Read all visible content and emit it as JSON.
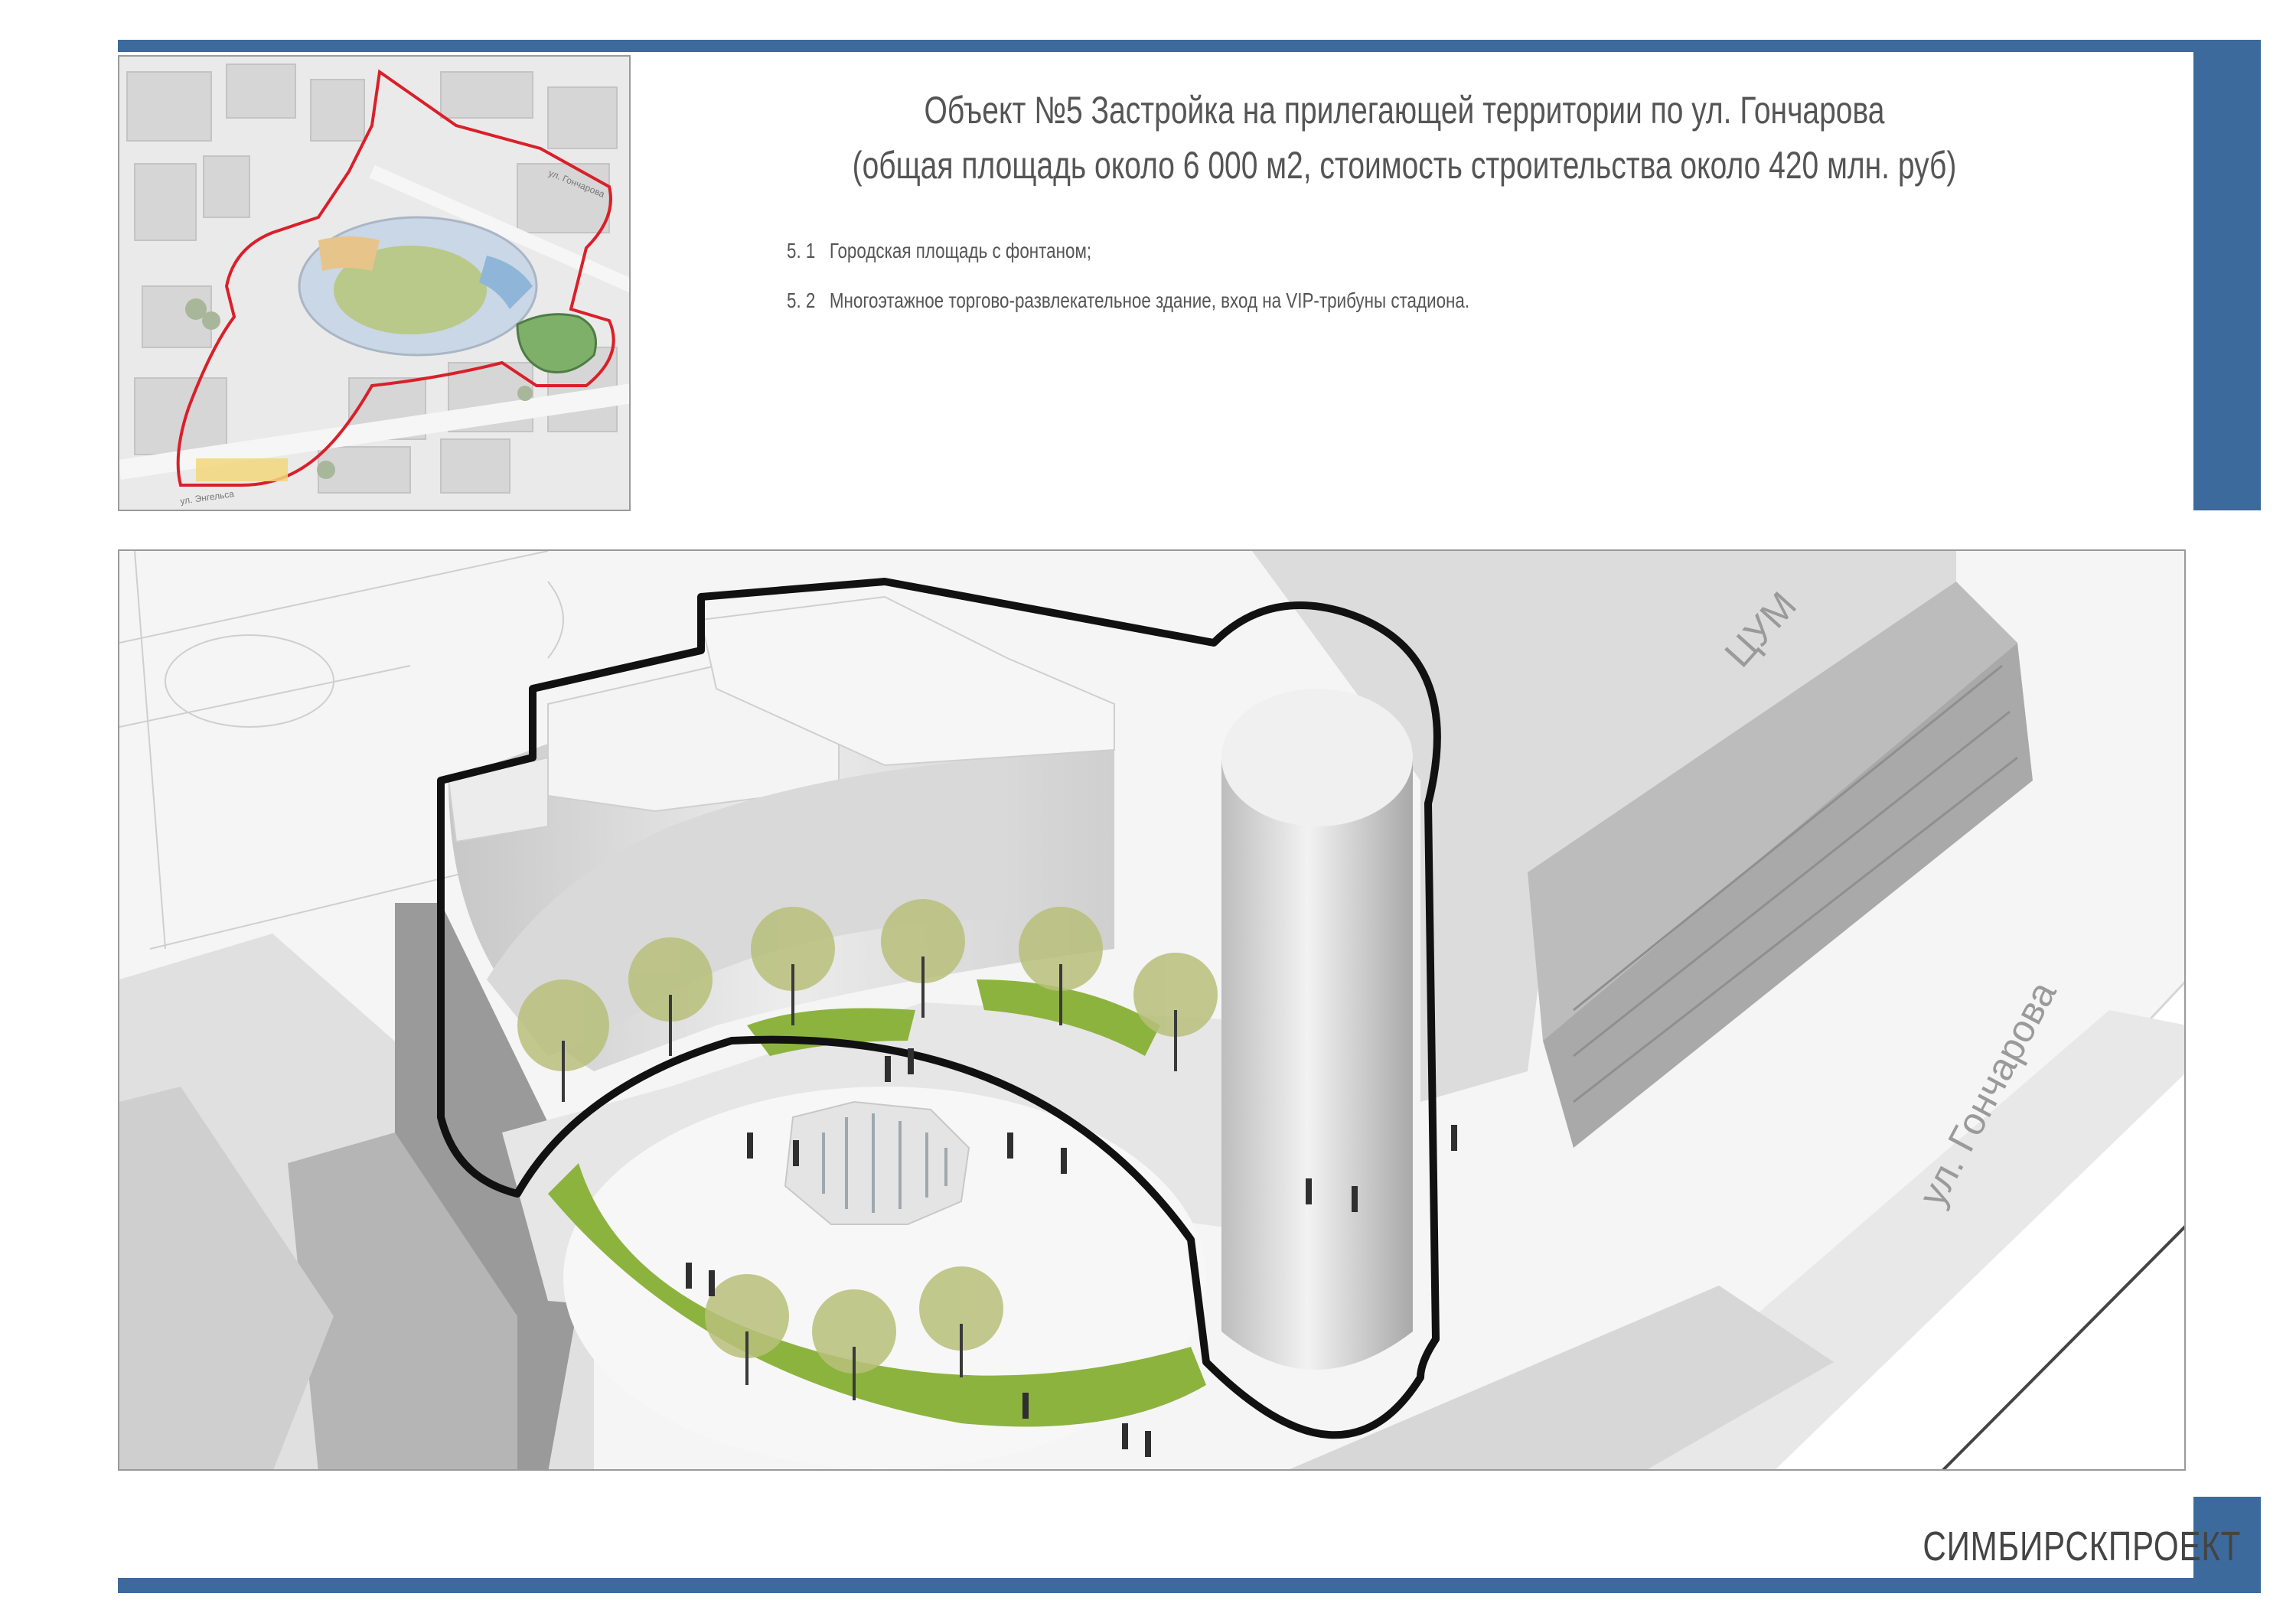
{
  "header": {
    "title_line1": "Объект №5  Застройка на прилегающей территории по ул. Гончарова",
    "title_line2": "(общая площадь около 6 000 м2, стоимость строительства около 420 млн. руб)"
  },
  "items": [
    {
      "number": "5. 1",
      "text": "Городская площадь с фонтаном;"
    },
    {
      "number": "5. 2",
      "text": "Многоэтажное торгово-развлекательное здание, вход на VIP-трибуны стадиона."
    }
  ],
  "inset_map": {
    "street_label_1": "ул. Гончарова",
    "street_label_2": "ул. Энгельса"
  },
  "render": {
    "label_tsum": "ЦУМ",
    "label_street": "ул. Гончарова"
  },
  "footer": {
    "brand": "СИМБИРСКПРОЕКТ"
  },
  "colors": {
    "frame_blue": "#3d6a9c",
    "outline_red": "#d9202a",
    "lawn_green": "#8db33f"
  }
}
